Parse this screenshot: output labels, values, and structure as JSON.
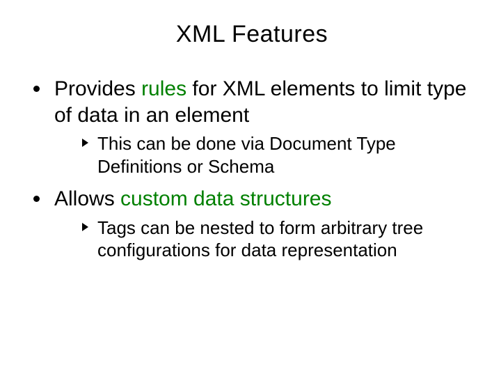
{
  "title": "XML Features",
  "bullets": [
    {
      "pre": "Provides ",
      "em": "rules",
      "post": " for XML elements to limit type of data in an element",
      "sub": "This can be done via Document Type Definitions or Schema"
    },
    {
      "pre": "Allows ",
      "em": "custom data structures",
      "post": "",
      "sub": "Tags can be nested to form arbitrary tree configurations for data representation"
    }
  ]
}
